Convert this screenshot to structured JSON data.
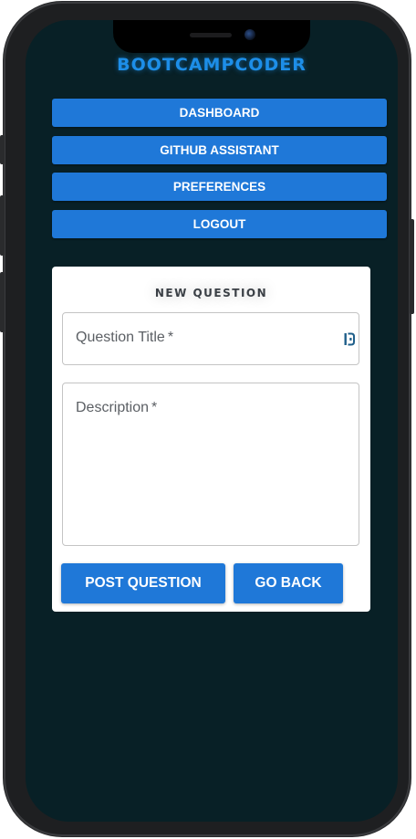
{
  "app": {
    "brand": "BOOTCAMPCODER"
  },
  "nav": {
    "items": [
      {
        "label": "DASHBOARD"
      },
      {
        "label": "GITHUB ASSISTANT"
      },
      {
        "label": "PREFERENCES"
      },
      {
        "label": "LOGOUT"
      }
    ]
  },
  "form": {
    "title": "NEW QUESTION",
    "question_title": {
      "label": "Question Title",
      "required_mark": "*"
    },
    "description": {
      "label": "Description",
      "required_mark": "*"
    },
    "post_label": "POST QUESTION",
    "back_label": "GO BACK"
  },
  "colors": {
    "accent": "#1f78d8",
    "screen_bg": "#082026",
    "brand": "#1d8ee8"
  },
  "icons": {
    "field_picker": "form-autofill-icon"
  }
}
